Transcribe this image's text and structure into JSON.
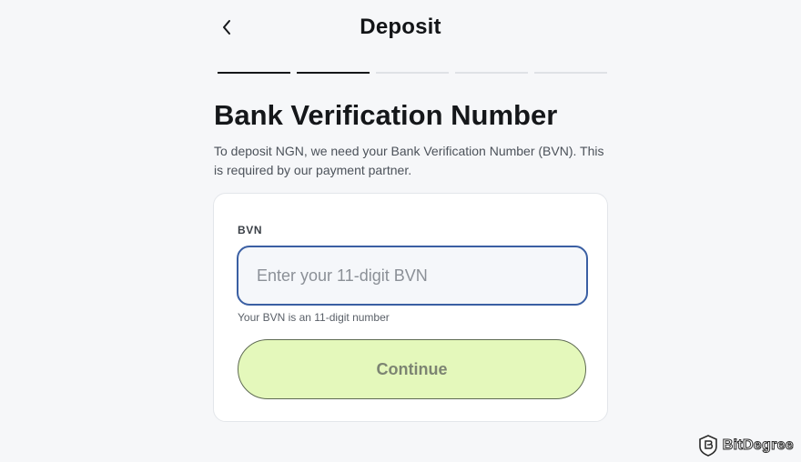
{
  "header": {
    "title": "Deposit"
  },
  "stepper": {
    "total_steps": 5,
    "completed_steps": 2
  },
  "section": {
    "title": "Bank Verification Number",
    "description": "To deposit NGN, we need your Bank Verification Number (BVN). This is required by our payment partner."
  },
  "form": {
    "bvn_label": "BVN",
    "bvn_value": "",
    "bvn_placeholder": "Enter your 11-digit BVN",
    "bvn_helper": "Your BVN is an 11-digit number",
    "continue_label": "Continue"
  },
  "watermark": {
    "text": "BitDegree"
  },
  "colors": {
    "input_border": "#3a5fa3",
    "continue_bg": "#e4f8bb",
    "page_bg": "#f6f7f9"
  }
}
